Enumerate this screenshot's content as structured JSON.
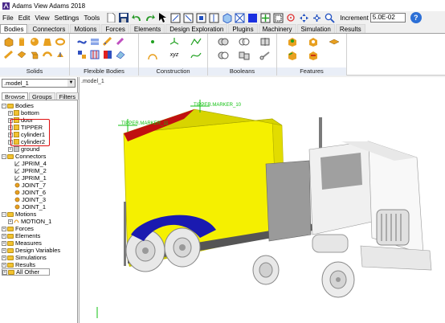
{
  "window": {
    "title": "Adams View Adams 2018"
  },
  "menu": [
    {
      "label": "File"
    },
    {
      "label": "Edit"
    },
    {
      "label": "View"
    },
    {
      "label": "Settings"
    },
    {
      "label": "Tools"
    }
  ],
  "toolbar": {
    "increment_label": "Increment",
    "increment_value": "5.0E-02"
  },
  "ribbon_tabs": [
    {
      "label": "Bodies",
      "active": true
    },
    {
      "label": "Connectors"
    },
    {
      "label": "Motions"
    },
    {
      "label": "Forces"
    },
    {
      "label": "Elements"
    },
    {
      "label": "Design Exploration"
    },
    {
      "label": "Plugins"
    },
    {
      "label": "Machinery"
    },
    {
      "label": "Simulation"
    },
    {
      "label": "Results"
    }
  ],
  "ribbon_groups": {
    "solids": "Solids",
    "flexible": "Flexible Bodies",
    "construction": "Construction",
    "booleans": "Booleans",
    "features": "Features"
  },
  "left_panel": {
    "model_select": ".model_1",
    "tabs": [
      {
        "label": "Browse",
        "active": true
      },
      {
        "label": "Groups"
      },
      {
        "label": "Filters"
      }
    ]
  },
  "tree": {
    "bodies": "Bodies",
    "bottom": "bottom",
    "door": "door",
    "tipper": "TIPPER",
    "cylinder1": "cylinder1",
    "cylinder2": "cylinder2",
    "ground": "ground",
    "connectors": "Connectors",
    "jprim4": "JPRIM_4",
    "jprim2": "JPRIM_2",
    "jprim1": "JPRIM_1",
    "joint7": "JOINT_7",
    "joint6": "JOINT_6",
    "joint3": "JOINT_3",
    "joint1": "JOINT_1",
    "motions": "Motions",
    "motion1": "MOTION_1",
    "forces": "Forces",
    "elements": "Elements",
    "measures": "Measures",
    "design_variables": "Design Variables",
    "simulations": "Simulations",
    "results": "Results",
    "all_other": "All Other"
  },
  "viewport": {
    "label": ".model_1",
    "marker1": "TIPPER.MARKER_11",
    "marker2": "TIPPER.MARKER_10"
  },
  "colors": {
    "body_yellow": "#f5f000",
    "wheel_blue": "#1a1ab0",
    "marker_green": "#10c010",
    "tipper_red": "#c01010",
    "truck_white": "#f4f4f4"
  }
}
